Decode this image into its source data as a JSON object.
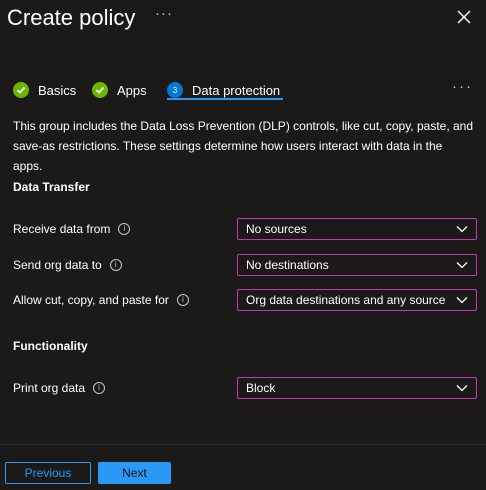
{
  "header": {
    "title": "Create policy",
    "more": "···"
  },
  "steps": {
    "items": [
      {
        "label": "Basics",
        "state": "complete"
      },
      {
        "label": "Apps",
        "state": "complete"
      },
      {
        "label": "Data protection",
        "state": "current",
        "number": "3"
      }
    ],
    "more": "···"
  },
  "description": "This group includes the Data Loss Prevention (DLP) controls, like cut, copy, paste, and save-as restrictions. These settings determine how users interact with data in the apps.",
  "sections": {
    "data_transfer": {
      "title": "Data Transfer",
      "rows": [
        {
          "label": "Receive data from",
          "value": "No sources"
        },
        {
          "label": "Send org data to",
          "value": "No destinations"
        },
        {
          "label": "Allow cut, copy, and paste for",
          "value": "Org data destinations and any source"
        }
      ]
    },
    "functionality": {
      "title": "Functionality",
      "rows": [
        {
          "label": "Print org data",
          "value": "Block"
        }
      ]
    }
  },
  "footer": {
    "previous": "Previous",
    "next": "Next"
  },
  "colors": {
    "accent": "#2899f5",
    "focus_border": "#c239b3",
    "check": "#6bb700",
    "background": "#1b1a19"
  },
  "icons": {
    "info": "info-icon",
    "close": "close-icon",
    "chevron": "chevron-down-icon",
    "check": "checkmark-icon"
  }
}
